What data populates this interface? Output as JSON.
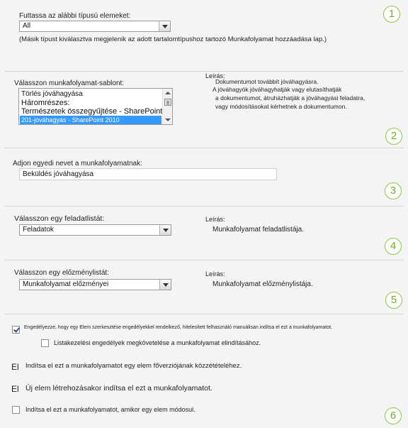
{
  "section1": {
    "label": "Futtassa az alábbi típusú elemeket:",
    "selected": "All",
    "note": "(Másik típust kiválasztva megjelenik az adott tartalomtípushoz tartozó Munkafolyamat hozzáadása lap.)",
    "step": "1"
  },
  "section2": {
    "label": "Válasszon munkafolyamat-sablont:",
    "options": [
      "Törlés jóváhagyása",
      "Háromrészes:",
      "Természetek összegyűjtése - SharePoint",
      "201-jóváhagyás - SharePoint 2010"
    ],
    "selected_index": 3,
    "desc_label": "Leírás:",
    "desc_lines": [
      "Dokumentumot továbbít jóváhagyásra.",
      "A jóváhagyók jóváhagyhatják vagy elutasíthatják",
      "a dokumentumot, átruházhatják a jóváhagyási feladatra,",
      "vagy módosításokat kérhetnek a dokumentumon."
    ],
    "step": "2"
  },
  "section3": {
    "label": "Adjon egyedi nevet a munkafolyamatnak:",
    "value": "Beküldés jóváhagyása",
    "step": "3"
  },
  "section4": {
    "label": "Válasszon egy feladatlistát:",
    "selected": "Feladatok",
    "desc_label": "Leírás:",
    "desc": "Munkafolyamat feladatlistája.",
    "step": "4"
  },
  "section5": {
    "label": "Válasszon egy előzménylistát:",
    "selected": "Munkafolyamat előzményei",
    "desc_label": "Leírás:",
    "desc": "Munkafolyamat előzménylistája.",
    "step": "5"
  },
  "section6": {
    "opt_allow_manual": {
      "label": "Engedélyezze, hogy egy Elem szerkesztése engedélyekkel rendelkező, hitelesített felhasználó manuálisan indítsa el ezt a munkafolyamatot.",
      "checked": true
    },
    "opt_require_manage": {
      "label": "Listakezelési engedélyek megkövetelése a munkafolyamat elindításához.",
      "checked": false
    },
    "opt_major_version": {
      "prefix": "El",
      "label": "Indítsa el ezt a munkafolyamatot egy elem főverziójának közzétételéhez."
    },
    "opt_new_item": {
      "prefix": "El",
      "label": "Új elem létrehozásakor indítsa el ezt a munkafolyamatot."
    },
    "opt_on_change": {
      "label": "Indítsa el ezt a munkafolyamatot, amikor egy elem módosul.",
      "checked": false
    },
    "step": "6"
  }
}
